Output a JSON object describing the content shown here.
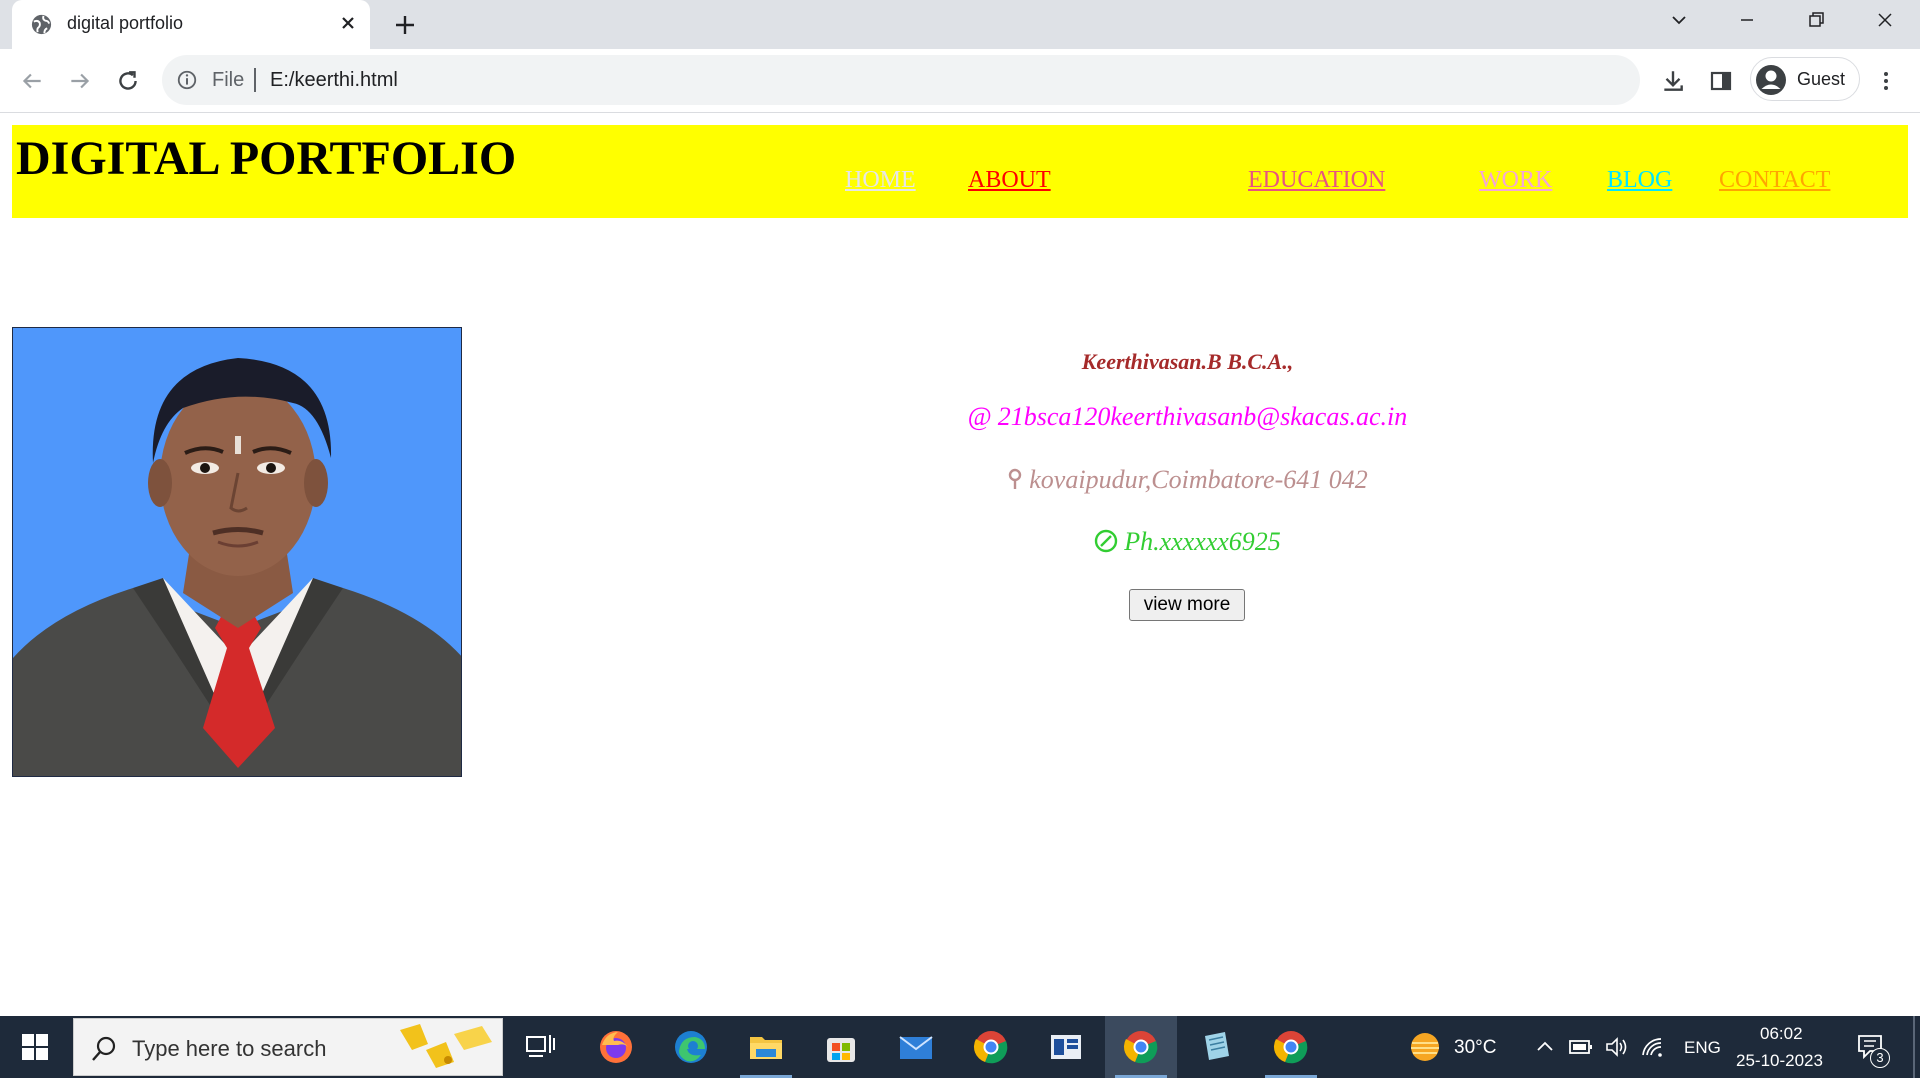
{
  "browser": {
    "tab_title": "digital portfolio",
    "omnibox_scheme": "File",
    "omnibox_url": "E:/keerthi.html",
    "profile_label": "Guest"
  },
  "site": {
    "title": "DIGITAL PORTFOLIO",
    "nav": [
      {
        "label": "HOME",
        "color": "#e6e6e6"
      },
      {
        "label": "ABOUT",
        "color": "#ff0000"
      },
      {
        "label": "EDUCATION",
        "color": "#e75480"
      },
      {
        "label": "WORK",
        "color": "#f4a6d7"
      },
      {
        "label": "BLOG",
        "color": "#00e5ff"
      },
      {
        "label": "CONTACT",
        "color": "#ffa500"
      }
    ],
    "header_color": "#ffff00"
  },
  "profile": {
    "name": "Keerthivasan.B B.C.A.,",
    "email": "21bsca120keerthivasanb@skacas.ac.in",
    "address": "kovaipudur,Coimbatore-641 042",
    "phone": "Ph.xxxxxx6925",
    "email_icon": "@",
    "view_more": "view more"
  },
  "taskbar": {
    "search_placeholder": "Type here to search",
    "temperature": "30°C",
    "language": "ENG",
    "time": "06:02",
    "date": "25-10-2023",
    "notification_count": "3"
  }
}
